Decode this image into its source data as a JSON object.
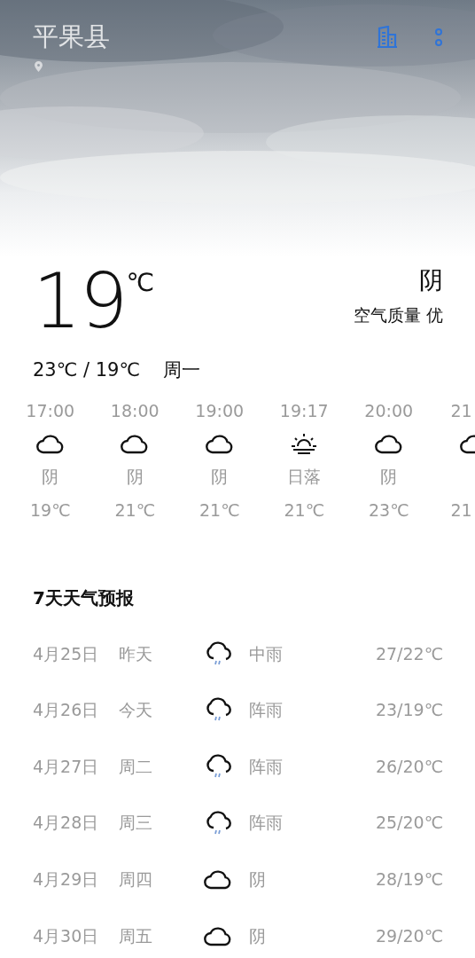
{
  "header": {
    "city": "平果县"
  },
  "current": {
    "temperature": "19",
    "unit": "℃",
    "condition": "阴",
    "air_quality": "空气质量 优",
    "range": "23℃ / 19℃",
    "weekday": "周一"
  },
  "hourly": [
    {
      "time": "17:00",
      "kind": "cloud",
      "condition": "阴",
      "temp": "19℃"
    },
    {
      "time": "18:00",
      "kind": "cloud",
      "condition": "阴",
      "temp": "21℃"
    },
    {
      "time": "19:00",
      "kind": "cloud",
      "condition": "阴",
      "temp": "21℃"
    },
    {
      "time": "19:17",
      "kind": "sunset",
      "condition": "日落",
      "temp": "21℃"
    },
    {
      "time": "20:00",
      "kind": "cloud",
      "condition": "阴",
      "temp": "23℃"
    },
    {
      "time": "21",
      "kind": "cloud",
      "temp": "21"
    }
  ],
  "forecast": {
    "title": "7天天气预报",
    "days": [
      {
        "date": "4月25日",
        "day": "昨天",
        "kind": "rain",
        "condition": "中雨",
        "temps": "27/22℃"
      },
      {
        "date": "4月26日",
        "day": "今天",
        "kind": "rain",
        "condition": "阵雨",
        "temps": "23/19℃"
      },
      {
        "date": "4月27日",
        "day": "周二",
        "kind": "rain",
        "condition": "阵雨",
        "temps": "26/20℃"
      },
      {
        "date": "4月28日",
        "day": "周三",
        "kind": "rain",
        "condition": "阵雨",
        "temps": "25/20℃"
      },
      {
        "date": "4月29日",
        "day": "周四",
        "kind": "cloud",
        "condition": "阴",
        "temps": "28/19℃"
      },
      {
        "date": "4月30日",
        "day": "周五",
        "kind": "cloud",
        "condition": "阴",
        "temps": "29/20℃"
      }
    ]
  }
}
